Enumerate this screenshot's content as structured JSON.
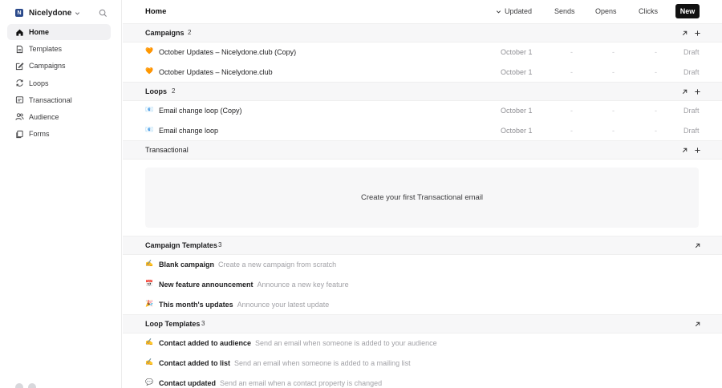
{
  "workspace": {
    "badge": "N",
    "name": "Nicelydone"
  },
  "sidebar": {
    "items": [
      {
        "label": "Home",
        "icon": "home-icon",
        "active": true
      },
      {
        "label": "Templates",
        "icon": "file-icon"
      },
      {
        "label": "Campaigns",
        "icon": "edit-icon"
      },
      {
        "label": "Loops",
        "icon": "loop-icon"
      },
      {
        "label": "Transactional",
        "icon": "mail-icon"
      },
      {
        "label": "Audience",
        "icon": "users-icon"
      },
      {
        "label": "Forms",
        "icon": "forms-icon"
      }
    ]
  },
  "header": {
    "title": "Home",
    "columns": {
      "updated": "Updated",
      "sends": "Sends",
      "opens": "Opens",
      "clicks": "Clicks"
    },
    "new_label": "New"
  },
  "sections": {
    "campaigns": {
      "title": "Campaigns",
      "count": "2"
    },
    "loops": {
      "title": "Loops",
      "count": "2"
    },
    "transactional": {
      "title": "Transactional",
      "empty": "Create your first Transactional email"
    },
    "campaign_templates": {
      "title": "Campaign Templates",
      "count": "3"
    },
    "loop_templates": {
      "title": "Loop Templates",
      "count": "3"
    }
  },
  "campaign_rows": [
    {
      "emoji": "🧡",
      "name": "October Updates – Nicelydone.club (Copy)",
      "date": "October 1",
      "sends": "-",
      "opens": "-",
      "clicks": "-",
      "status": "Draft"
    },
    {
      "emoji": "🧡",
      "name": "October Updates – Nicelydone.club",
      "date": "October 1",
      "sends": "-",
      "opens": "-",
      "clicks": "-",
      "status": "Draft"
    }
  ],
  "loop_rows": [
    {
      "emoji": "📧",
      "name": "Email change loop (Copy)",
      "date": "October 1",
      "sends": "-",
      "opens": "-",
      "clicks": "-",
      "status": "Draft"
    },
    {
      "emoji": "📧",
      "name": "Email change loop",
      "date": "October 1",
      "sends": "-",
      "opens": "-",
      "clicks": "-",
      "status": "Draft"
    }
  ],
  "campaign_templates": [
    {
      "emoji": "✍️",
      "name": "Blank campaign",
      "desc": "Create a new campaign from scratch"
    },
    {
      "emoji": "📅",
      "name": "New feature announcement",
      "desc": "Announce a new key feature"
    },
    {
      "emoji": "🎉",
      "name": "This month's updates",
      "desc": "Announce your latest update"
    }
  ],
  "loop_templates": [
    {
      "emoji": "✍️",
      "name": "Contact added to audience",
      "desc": "Send an email when someone is added to your audience"
    },
    {
      "emoji": "✍️",
      "name": "Contact added to list",
      "desc": "Send an email when someone is added to a mailing list"
    },
    {
      "emoji": "💬",
      "name": "Contact updated",
      "desc": "Send an email when a contact property is changed"
    }
  ],
  "colors": {
    "accent": "#111111",
    "section_bg": "#f7f7f8",
    "active_nav_bg": "#f1f1f3",
    "muted": "#a1a1a6"
  }
}
